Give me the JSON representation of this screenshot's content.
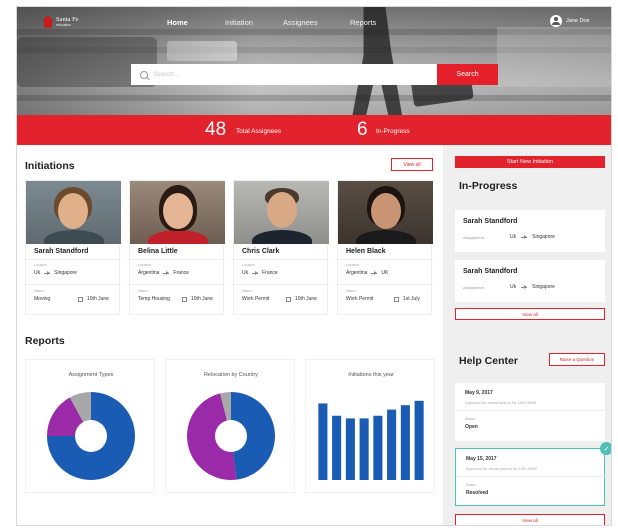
{
  "nav": {
    "logo_text": "Santa Fe",
    "logo_sub": "relocation",
    "items": [
      "Home",
      "Initiation",
      "Assignees",
      "Reports"
    ],
    "user_name": "Jane Doe"
  },
  "search": {
    "placeholder": "Search...",
    "button_label": "Search"
  },
  "stats": {
    "total_value": "48",
    "total_label": "Total Assignees",
    "progress_value": "6",
    "progress_label": "In-Progress"
  },
  "initiations": {
    "title": "Initiations",
    "view_all": "View all",
    "location_label": "Location",
    "status_label": "Status",
    "cards": [
      {
        "name": "Sarah Standford",
        "from": "Uk",
        "to": "Singapore",
        "status": "Moving",
        "date": "10th June"
      },
      {
        "name": "Belina Little",
        "from": "Argentina",
        "to": "France",
        "status": "Temp Housing",
        "date": "10th June"
      },
      {
        "name": "Chris Clark",
        "from": "Uk",
        "to": "France",
        "status": "Work Permit",
        "date": "10th June"
      },
      {
        "name": "Helen Black",
        "from": "Argentina",
        "to": "UK",
        "status": "Work Permit",
        "date": "1st July"
      }
    ]
  },
  "reports": {
    "title": "Reports"
  },
  "chart_data": [
    {
      "type": "pie",
      "title": "Assignment Types",
      "labels": [
        "",
        "",
        ""
      ],
      "values": [
        75,
        17,
        8
      ],
      "colors": [
        "#1a5bb3",
        "#9b2aa8",
        "#a8a8a8"
      ],
      "donut": true
    },
    {
      "type": "pie",
      "title": "Relocation by Country",
      "labels": [
        "",
        "",
        ""
      ],
      "values": [
        48,
        48,
        4
      ],
      "colors": [
        "#1a5bb3",
        "#9b2aa8",
        "#a8a8a8"
      ],
      "donut": true
    },
    {
      "type": "bar",
      "title": "Initiations this year",
      "categories": [
        "",
        "",
        "",
        "",
        "",
        "",
        "",
        ""
      ],
      "values": [
        87,
        73,
        70,
        70,
        73,
        80,
        85,
        90
      ],
      "ylim": [
        0,
        100
      ],
      "color": "#1a5bb3"
    }
  ],
  "right": {
    "start_button": "Start New Initiation",
    "progress_title": "In-Progress",
    "assignment_label": "Assignment",
    "progress_items": [
      {
        "name": "Sarah Standford",
        "from": "Uk",
        "to": "Singapore"
      },
      {
        "name": "Sarah Standford",
        "from": "Uk",
        "to": "Singapore"
      }
    ],
    "view_all": "View all",
    "help_title": "Help Center",
    "ask_button": "Raise a Question",
    "status_label": "Status",
    "help_items": [
      {
        "date": "May 9, 2017",
        "desc": "Approval for rental search for USD $500",
        "status": "Open"
      },
      {
        "date": "May 15, 2017",
        "desc": "Approval for rental search for USD $500",
        "status": "Resolved"
      }
    ],
    "help_view_all": "View all"
  },
  "colors": {
    "accent": "#e2232e",
    "chart_blue": "#1a5bb3",
    "chart_purple": "#9b2aa8",
    "resolved_teal": "#4fc0b8"
  }
}
